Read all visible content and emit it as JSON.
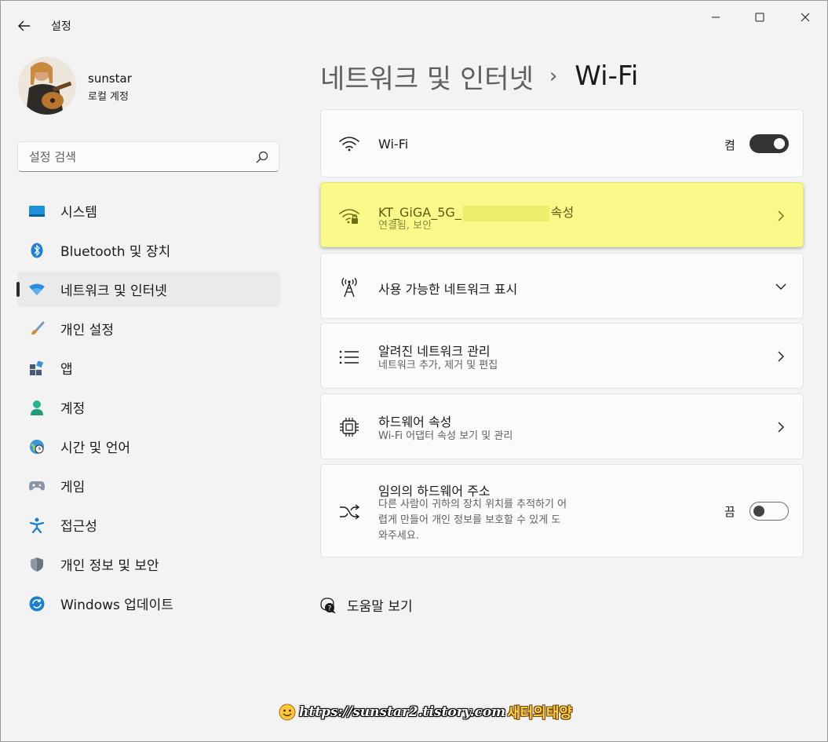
{
  "window": {
    "title": "설정"
  },
  "user": {
    "name": "sunstar",
    "account_type": "로컬 계정"
  },
  "search": {
    "placeholder": "설정 검색"
  },
  "sidebar": {
    "items": [
      {
        "label": "시스템",
        "icon": "system-icon"
      },
      {
        "label": "Bluetooth 및 장치",
        "icon": "bluetooth-icon"
      },
      {
        "label": "네트워크 및 인터넷",
        "icon": "wifi-icon",
        "active": true
      },
      {
        "label": "개인 설정",
        "icon": "brush-icon"
      },
      {
        "label": "앱",
        "icon": "apps-icon"
      },
      {
        "label": "계정",
        "icon": "account-icon"
      },
      {
        "label": "시간 및 언어",
        "icon": "globe-clock-icon"
      },
      {
        "label": "게임",
        "icon": "gamepad-icon"
      },
      {
        "label": "접근성",
        "icon": "accessibility-icon"
      },
      {
        "label": "개인 정보 및 보안",
        "icon": "shield-icon"
      },
      {
        "label": "Windows 업데이트",
        "icon": "update-icon"
      }
    ]
  },
  "breadcrumb": {
    "parent": "네트워크 및 인터넷",
    "separator": "›",
    "current": "Wi-Fi"
  },
  "cards": {
    "wifi": {
      "title": "Wi-Fi",
      "state_label": "켬",
      "on": true
    },
    "connected": {
      "ssid_prefix": "KT_GiGA_5G_",
      "suffix": "속성",
      "status": "연결됨, 보안"
    },
    "available": {
      "title": "사용 가능한 네트워크 표시"
    },
    "known": {
      "title": "알려진 네트워크 관리",
      "sub": "네트워크 추가, 제거 및 편집"
    },
    "hardware": {
      "title": "하드웨어 속성",
      "sub": "Wi-Fi 어댑터 속성 보기 및 관리"
    },
    "random_mac": {
      "title": "임의의 하드웨어 주소",
      "sub_lines": [
        "다른 사람이 귀하의 장치 위치를 추적하기 어",
        "렵게 만들어 개인 정보를 보호할 수 있게 도",
        "와주세요."
      ],
      "state_label": "끔",
      "on": false
    }
  },
  "help": {
    "label": "도움말 보기"
  },
  "watermark": {
    "url": "https://sunstar2.tistory.com",
    "name": "새터의태양"
  },
  "colors": {
    "highlight": "#f9f98a",
    "accent": "#0067c0"
  }
}
